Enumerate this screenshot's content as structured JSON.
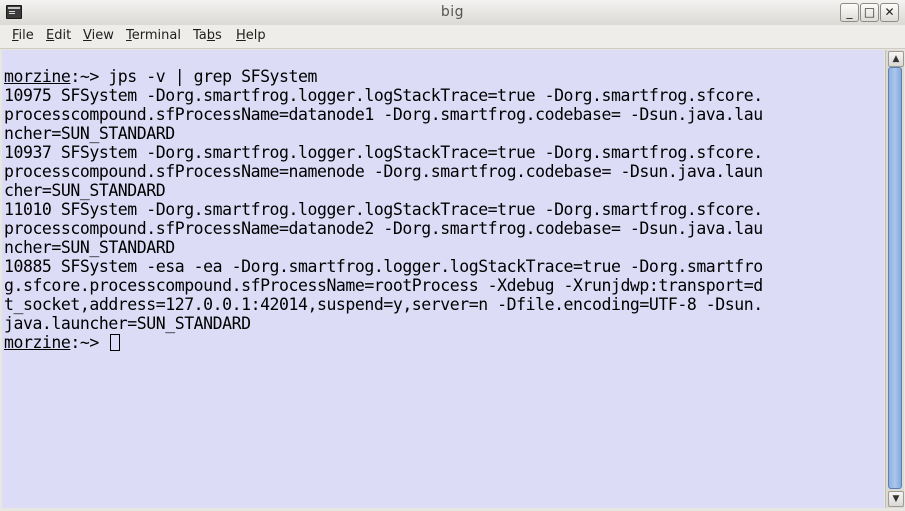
{
  "window": {
    "title": "big",
    "minimize_label": "_",
    "maximize_label": "□",
    "close_label": "✕",
    "icon": "terminal-icon"
  },
  "menubar": {
    "items": [
      {
        "label": "File",
        "underline_index": 0
      },
      {
        "label": "Edit",
        "underline_index": 0
      },
      {
        "label": "View",
        "underline_index": 0
      },
      {
        "label": "Terminal",
        "underline_index": 0
      },
      {
        "label": "Tabs",
        "underline_index": 2
      },
      {
        "label": "Help",
        "underline_index": 0
      }
    ]
  },
  "terminal": {
    "prompt_host": "morzine",
    "prompt_suffix": ":~> ",
    "command": "jps -v | grep SFSystem",
    "output_lines": [
      "10975 SFSystem -Dorg.smartfrog.logger.logStackTrace=true -Dorg.smartfrog.sfcore.",
      "processcompound.sfProcessName=datanode1 -Dorg.smartfrog.codebase= -Dsun.java.lau",
      "ncher=SUN_STANDARD",
      "10937 SFSystem -Dorg.smartfrog.logger.logStackTrace=true -Dorg.smartfrog.sfcore.",
      "processcompound.sfProcessName=namenode -Dorg.smartfrog.codebase= -Dsun.java.laun",
      "cher=SUN_STANDARD",
      "11010 SFSystem -Dorg.smartfrog.logger.logStackTrace=true -Dorg.smartfrog.sfcore.",
      "processcompound.sfProcessName=datanode2 -Dorg.smartfrog.codebase= -Dsun.java.lau",
      "ncher=SUN_STANDARD",
      "10885 SFSystem -esa -ea -Dorg.smartfrog.logger.logStackTrace=true -Dorg.smartfro",
      "g.sfcore.processcompound.sfProcessName=rootProcess -Xdebug -Xrunjdwp:transport=d",
      "t_socket,address=127.0.0.1:42014,suspend=y,server=n -Dfile.encoding=UTF-8 -Dsun.",
      "java.launcher=SUN_STANDARD"
    ]
  },
  "scrollbar": {
    "up_icon": "arrow-up-icon",
    "down_icon": "arrow-down-icon"
  }
}
